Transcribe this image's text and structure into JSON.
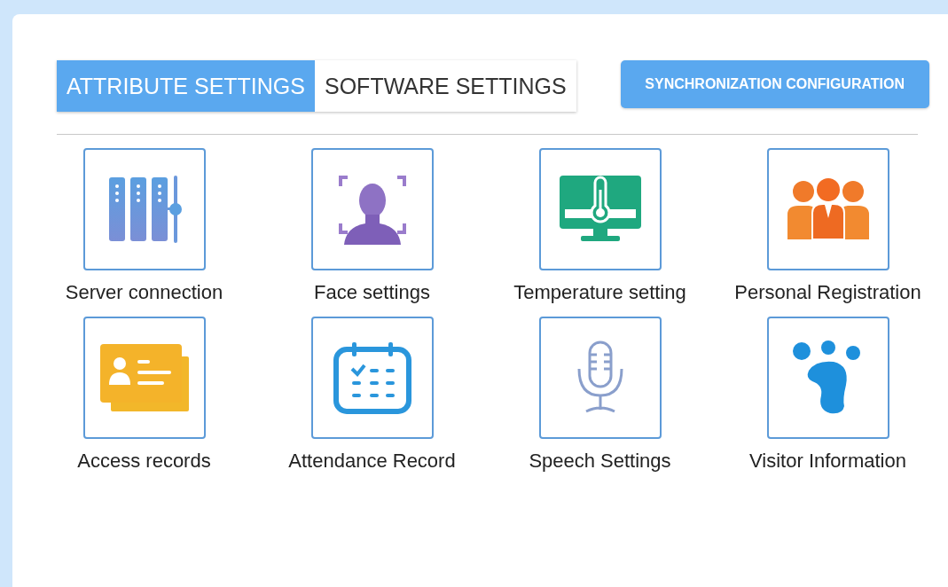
{
  "tabs": [
    {
      "label": "ATTRIBUTE SETTINGS",
      "selected": true
    },
    {
      "label": "SOFTWARE SETTINGS",
      "selected": false
    }
  ],
  "sync_button": {
    "label": "SYNCHRONIZATION CONFIGURATION"
  },
  "items": [
    {
      "label": "Server connection",
      "kind": "server"
    },
    {
      "label": "Face settings",
      "kind": "face"
    },
    {
      "label": "Temperature setting",
      "kind": "temperature"
    },
    {
      "label": "Personal Registration",
      "kind": "people"
    },
    {
      "label": "Access records",
      "kind": "card"
    },
    {
      "label": "Attendance Record",
      "kind": "calendar"
    },
    {
      "label": "Speech Settings",
      "kind": "microphone"
    },
    {
      "label": "Visitor Information",
      "kind": "footprint"
    }
  ]
}
